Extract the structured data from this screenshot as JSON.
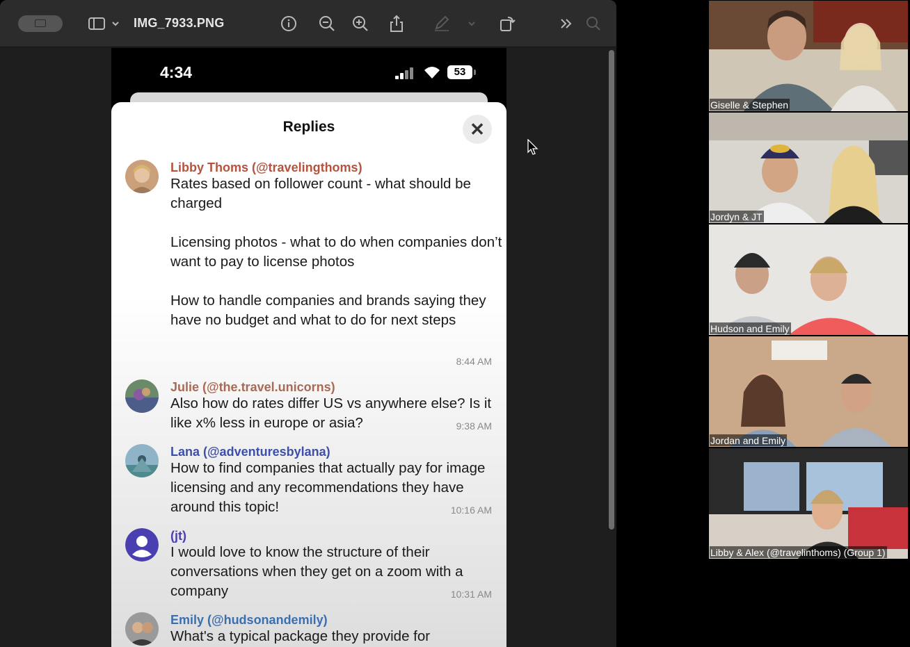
{
  "preview": {
    "title": "IMG_7933.PNG",
    "toolbar_icons": [
      "sidebar-icon",
      "chevron-down-icon",
      "info-icon",
      "zoom-out-icon",
      "zoom-in-icon",
      "share-icon",
      "markup-icon",
      "rotate-icon",
      "more-chevrons-icon",
      "search-icon"
    ]
  },
  "phone": {
    "time": "4:34",
    "battery": "53",
    "sheet_title": "Replies",
    "close_glyph": "✕",
    "replies": [
      {
        "name": "Libby Thoms (@travelingthoms)",
        "name_color": "#b5533e",
        "text": "Rates based on follower count - what should be charged\n\nLicensing photos - what to do when companies don’t want to pay to license photos\n\nHow to handle companies and brands saying they have no budget and what to do for next steps",
        "time": "8:44 AM"
      },
      {
        "name": "Julie (@the.travel.unicorns)",
        "name_color": "#a86a55",
        "text": "Also how do rates differ US vs anywhere else? Is it like x% less in europe or asia?",
        "time": "9:38 AM"
      },
      {
        "name": "Lana (@adventuresbylana)",
        "name_color": "#3d4fa8",
        "text": "How to find companies that actually pay for image licensing and any recommendations they have around this topic!",
        "time": "10:16 AM"
      },
      {
        "name": "(jt)",
        "name_color": "#4a3fb0",
        "text": "I would love to know the structure of their conversations when they get on a zoom with a company",
        "time": "10:31 AM"
      },
      {
        "name": "Emily (@hudsonandemily)",
        "name_color": "#3a6fb0",
        "text": "What's a typical package they provide for",
        "time": ""
      }
    ]
  },
  "participants": [
    {
      "label": "Giselle & Stephen"
    },
    {
      "label": "Jordyn & JT"
    },
    {
      "label": "Hudson and Emily"
    },
    {
      "label": "Jordan and Emily"
    },
    {
      "label": "Libby & Alex (@travelinthoms) (Group 1)"
    }
  ]
}
